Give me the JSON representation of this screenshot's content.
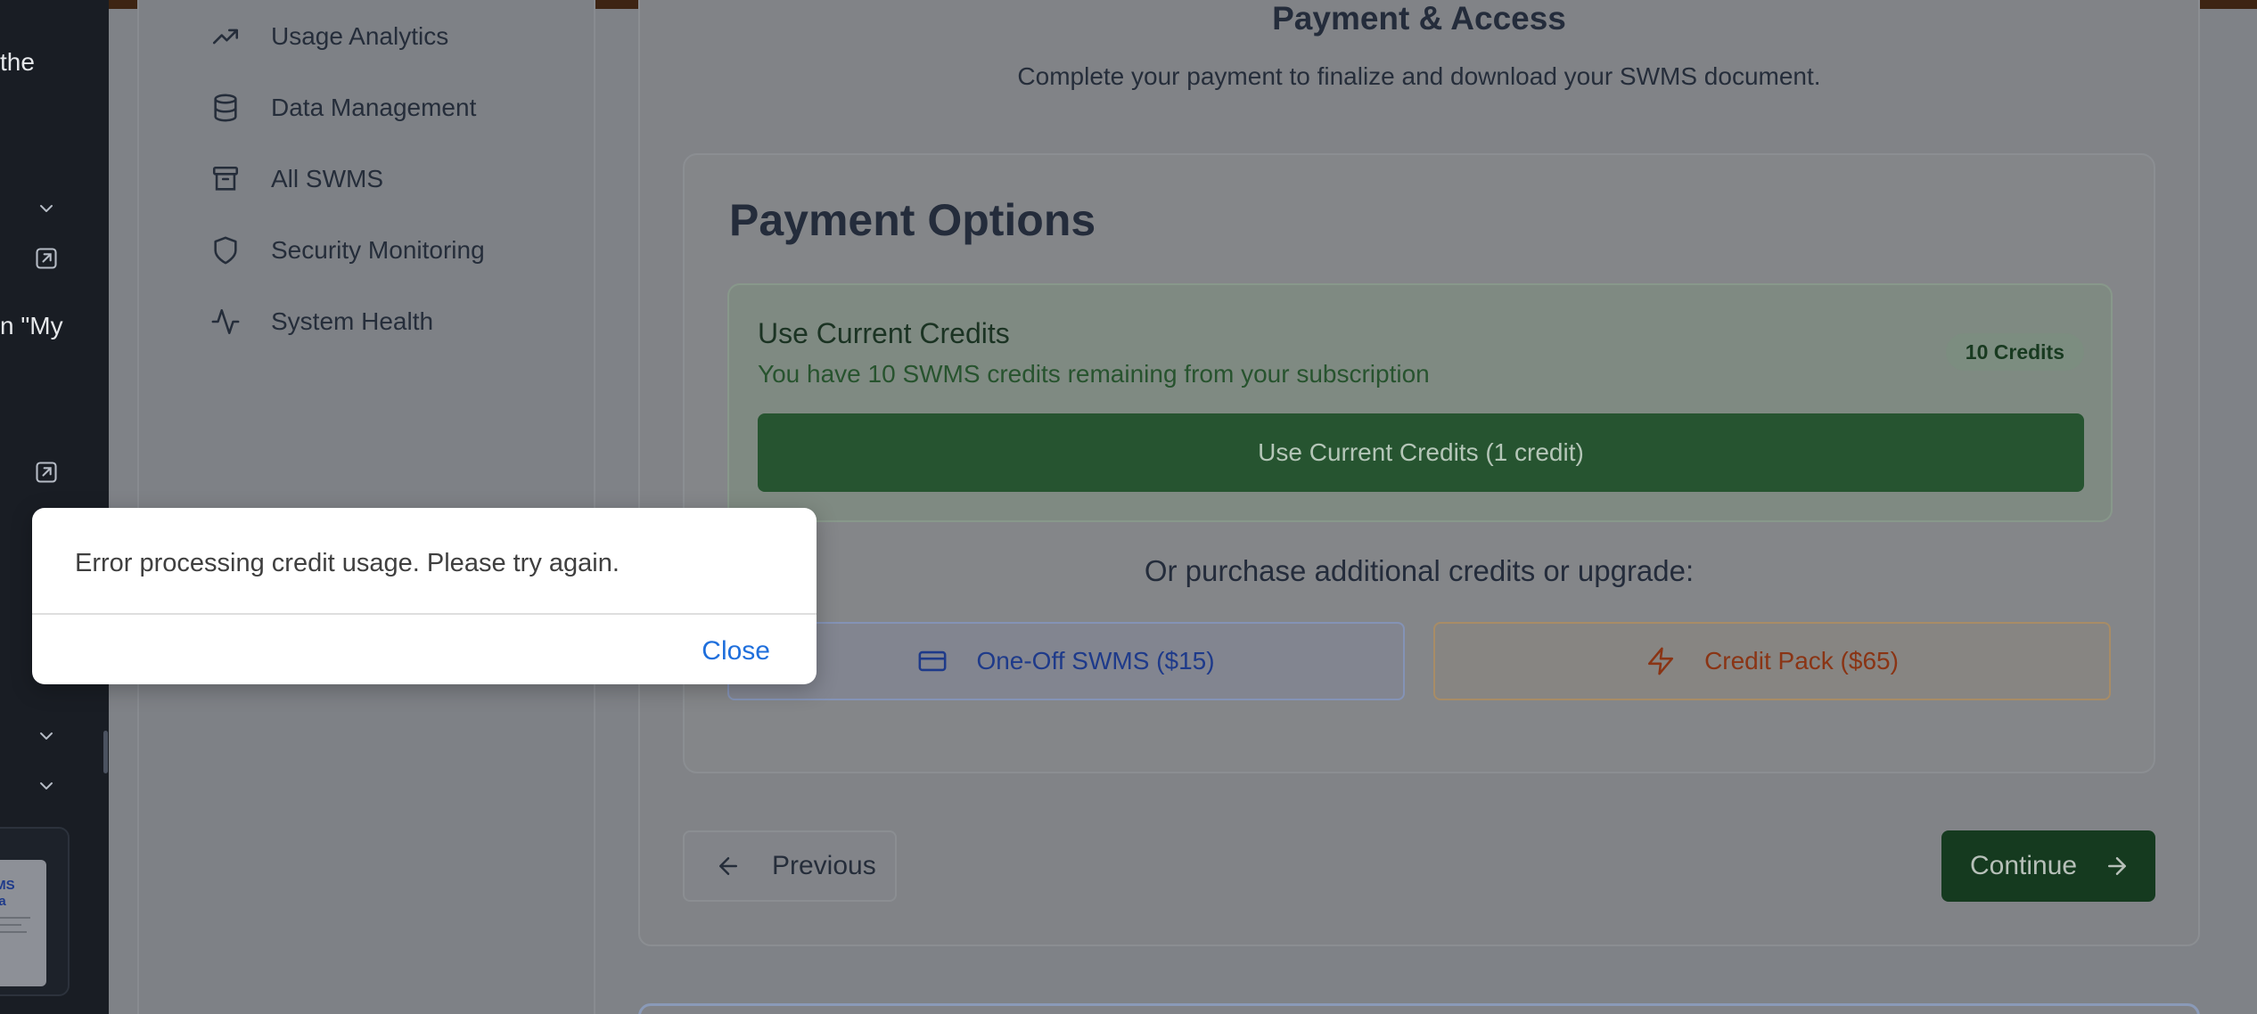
{
  "left_panel": {
    "fragment_1": "the",
    "fragment_2": "n \"My",
    "thumbnail_line_1": "/MS",
    "thumbnail_line_2": "lia"
  },
  "admin_nav": {
    "items": [
      {
        "label": "Usage Analytics",
        "icon": "trending-up-icon"
      },
      {
        "label": "Data Management",
        "icon": "database-icon"
      },
      {
        "label": "All SWMS",
        "icon": "archive-icon"
      },
      {
        "label": "Security Monitoring",
        "icon": "shield-icon"
      },
      {
        "label": "System Health",
        "icon": "activity-icon"
      }
    ]
  },
  "step": {
    "title": "Payment & Access",
    "subtitle": "Complete your payment to finalize and download your SWMS document."
  },
  "payment": {
    "title": "Payment Options",
    "credits": {
      "heading": "Use Current Credits",
      "description": "You have 10 SWMS credits remaining from your subscription",
      "badge": "10 Credits",
      "button": "Use Current Credits (1 credit)"
    },
    "or_text": "Or purchase additional credits or upgrade:",
    "one_off_button": "One-Off SWMS ($15)",
    "credit_pack_button": "Credit Pack ($65)"
  },
  "navigation": {
    "previous": "Previous",
    "continue": "Continue"
  },
  "modal": {
    "message": "Error processing credit usage. Please try again.",
    "close": "Close"
  },
  "colors": {
    "primary_green": "#265430",
    "dark_green": "#153a1f",
    "link_blue": "#1f6fdc",
    "sidebar_dark": "#191d24"
  }
}
